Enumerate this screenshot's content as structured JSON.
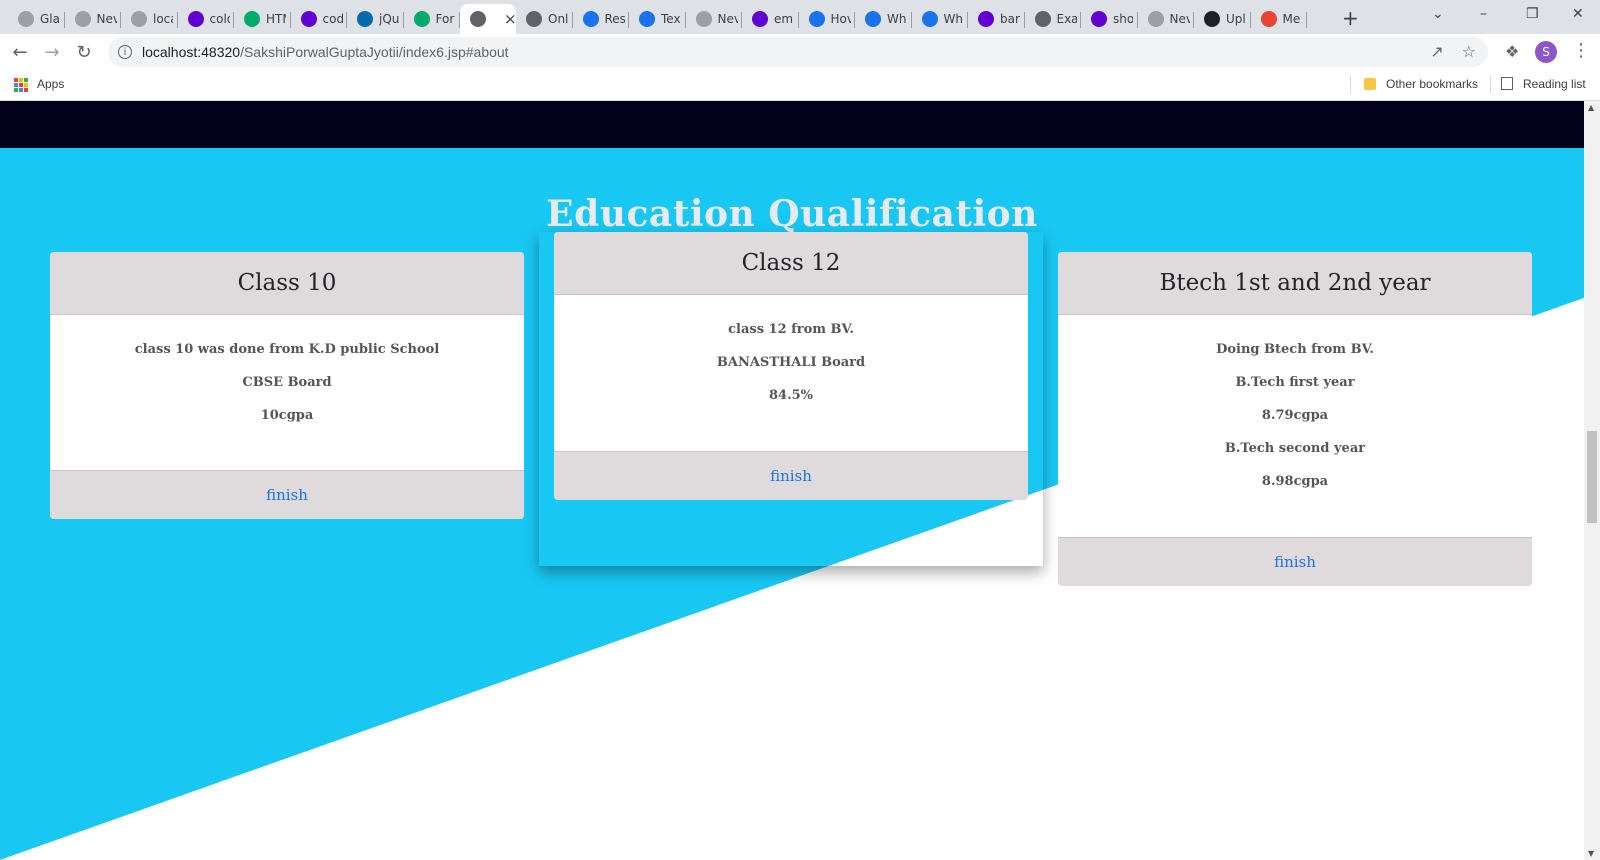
{
  "browser": {
    "tabs": [
      {
        "label": "Gla",
        "favicon": "globe-icon",
        "color": "#9aa0a6"
      },
      {
        "label": "Nev",
        "favicon": "globe-icon",
        "color": "#9aa0a6"
      },
      {
        "label": "loca",
        "favicon": "globe-icon",
        "color": "#9aa0a6"
      },
      {
        "label": "colo",
        "favicon": "yahoo-icon",
        "color": "#6001d2"
      },
      {
        "label": "HTM",
        "favicon": "w3schools-icon",
        "color": "#04aa6d"
      },
      {
        "label": "cod",
        "favicon": "yahoo-icon",
        "color": "#6001d2"
      },
      {
        "label": "jQu",
        "favicon": "jquery-icon",
        "color": "#0769ad"
      },
      {
        "label": "For",
        "favicon": "w3schools-icon",
        "color": "#04aa6d"
      },
      {
        "label": "",
        "favicon": "globe-icon",
        "color": "#5f6368",
        "active": true
      },
      {
        "label": "Onl",
        "favicon": "pen-icon",
        "color": "#5f6368"
      },
      {
        "label": "Res",
        "favicon": "coding-ninjas-icon",
        "color": "#1a73e8"
      },
      {
        "label": "Tex",
        "favicon": "coding-ninjas-icon",
        "color": "#1a73e8"
      },
      {
        "label": "Nev",
        "favicon": "globe-icon",
        "color": "#9aa0a6"
      },
      {
        "label": "em",
        "favicon": "yahoo-icon",
        "color": "#6001d2"
      },
      {
        "label": "Hov",
        "favicon": "c-icon",
        "color": "#1a73e8"
      },
      {
        "label": "Wh",
        "favicon": "c-icon",
        "color": "#1a73e8"
      },
      {
        "label": "Wh",
        "favicon": "c-icon",
        "color": "#1a73e8"
      },
      {
        "label": "bar",
        "favicon": "yahoo-icon",
        "color": "#6001d2"
      },
      {
        "label": "Exa",
        "favicon": "star-icon",
        "color": "#5f6368"
      },
      {
        "label": "sho",
        "favicon": "yahoo-icon",
        "color": "#6001d2"
      },
      {
        "label": "Nev",
        "favicon": "globe-icon",
        "color": "#9aa0a6"
      },
      {
        "label": "Upl",
        "favicon": "github-icon",
        "color": "#202124"
      },
      {
        "label": "Me",
        "favicon": "google-icon",
        "color": "#ea4335"
      }
    ],
    "url_host": "localhost:48320",
    "url_path": "/SakshiPorwalGuptaJyotii/index6.jsp#about",
    "profile_initial": "S",
    "bookmarks": {
      "apps": "Apps",
      "other": "Other bookmarks",
      "reading": "Reading list"
    }
  },
  "page": {
    "section_title": "Education Qualification",
    "colors": {
      "accent_bg": "#18c8f3",
      "dark_bar": "#02001a",
      "card_header": "#dfdadb",
      "link": "#1a73e8"
    },
    "cards": [
      {
        "title": "Class 10",
        "lines": [
          "class 10 was done from K.D public School",
          "CBSE Board",
          "10cgpa"
        ],
        "footer": "finish"
      },
      {
        "title": "Class 12",
        "lines": [
          "class 12 from BV.",
          "BANASTHALI Board",
          "84.5%"
        ],
        "footer": "finish"
      },
      {
        "title": "Btech 1st and 2nd year",
        "lines": [
          "Doing Btech from BV.",
          "B.Tech first year",
          "8.79cgpa",
          "B.Tech second year",
          "8.98cgpa"
        ],
        "footer": "finish"
      }
    ]
  }
}
